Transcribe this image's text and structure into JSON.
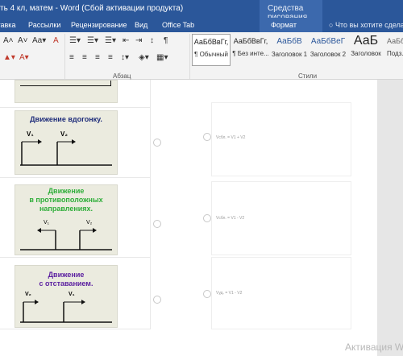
{
  "window": {
    "title": "ть 4 кл, матем - Word (Сбой активации продукта)",
    "context_group": "Средства рисования"
  },
  "tabs": {
    "items": [
      {
        "label": "Вставка"
      },
      {
        "label": "Рассылки"
      },
      {
        "label": "Рецензирование"
      },
      {
        "label": "Вид"
      },
      {
        "label": "Office Tab"
      }
    ],
    "format": "Формат",
    "tell_me": "Что вы хотите сделать?"
  },
  "ribbon": {
    "group_paragraph": "Абзац",
    "group_styles": "Стили",
    "styles": [
      {
        "sample": "АаБбВвГг,",
        "name": "¶ Обычный",
        "selected": true
      },
      {
        "sample": "АаБбВвГг,",
        "name": "¶ Без инте..."
      },
      {
        "sample": "АаБбВ",
        "name": "Заголовок 1"
      },
      {
        "sample": "АаБбВеГ",
        "name": "Заголовок 2"
      },
      {
        "sample": "АаБ",
        "name": "Заголовок"
      },
      {
        "sample": "АаБбВв",
        "name": "Подз..."
      }
    ]
  },
  "doc": {
    "cards": [
      {
        "title": "Движение вдогонку.",
        "label1": "V₁",
        "label2": "V₂",
        "color": "#1f2d7a"
      },
      {
        "title": "Движение\nв противоположных\nнаправлениях.",
        "label1": "V₁",
        "label2": "V₂",
        "color": "#2fae3a"
      },
      {
        "title": "Движение\nс отставанием.",
        "label1": "V₂",
        "label2": "V₁",
        "color": "#5b1fa0"
      }
    ],
    "formulas": [
      "Vсбл. = V1 + V2",
      "Vсбл. = V1 - V2",
      "Vуд. = V1 - V2"
    ]
  },
  "watermark": "Активация W"
}
